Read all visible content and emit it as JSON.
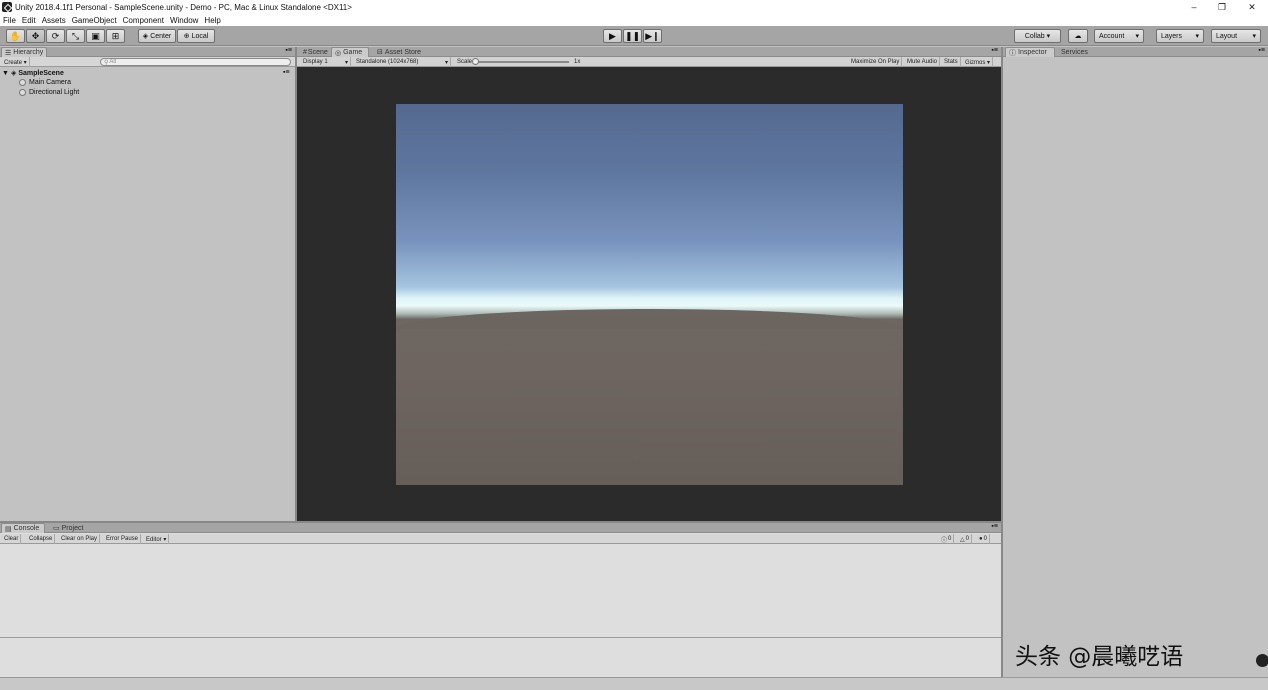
{
  "window": {
    "title": "Unity 2018.4.1f1 Personal - SampleScene.unity - Demo - PC, Mac & Linux Standalone <DX11>",
    "minimize": "–",
    "restore": "❐",
    "close": "✕"
  },
  "menu": [
    "File",
    "Edit",
    "Assets",
    "GameObject",
    "Component",
    "Window",
    "Help"
  ],
  "toolbar": {
    "pivot": "Center",
    "space": "Local",
    "collab": "Collab ▾",
    "account": "Account",
    "layers": "Layers",
    "layout": "Layout"
  },
  "hierarchy": {
    "tab": "Hierarchy",
    "create": "Create ▾",
    "search_placeholder": "All",
    "scene": "SampleScene",
    "items": [
      "Main Camera",
      "Directional Light"
    ]
  },
  "center": {
    "tabs": [
      "Scene",
      "Game",
      "Asset Store"
    ],
    "display": "Display 1",
    "resolution": "Standalone (1024x768)",
    "scale_label": "Scale",
    "scale_value": "1x",
    "scale_level": 0,
    "buttons": [
      "Maximize On Play",
      "Mute Audio",
      "Stats",
      "Gizmos ▾"
    ]
  },
  "inspector": {
    "tabs": [
      "Inspector",
      "Services"
    ]
  },
  "console": {
    "tabs": [
      "Console",
      "Project"
    ],
    "buttons": [
      "Clear",
      "Collapse",
      "Clear on Play",
      "Error Pause",
      "Editor ▾"
    ],
    "counts": {
      "info": "0",
      "warning": "0",
      "error": "0"
    }
  },
  "watermark": "头条 @晨曦呓语",
  "colors": {
    "toolbar_bg": "#a5a5a5",
    "panel_bg": "#c2c2c2",
    "game_bg": "#2b2b2b",
    "sky_top": "#55698f",
    "ground": "#6c645e"
  }
}
